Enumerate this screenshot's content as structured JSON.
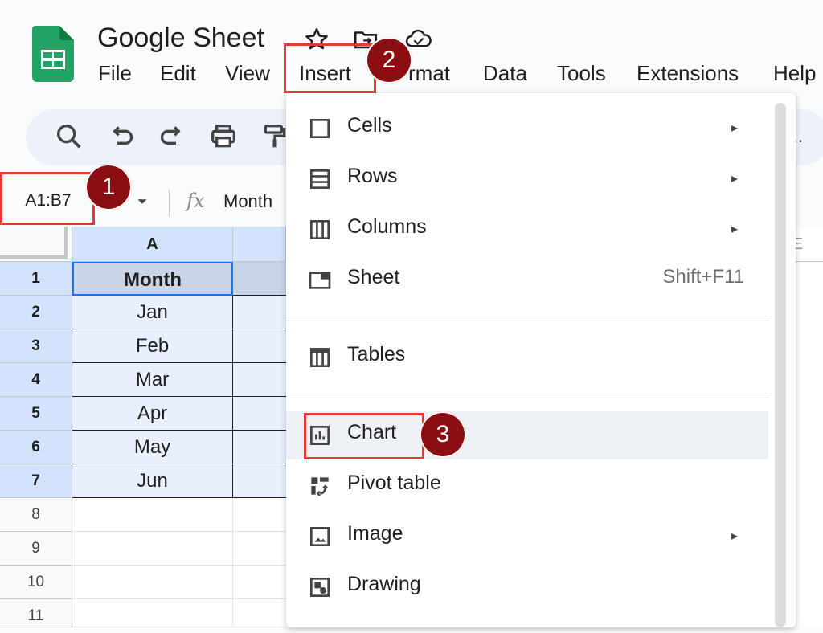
{
  "app": {
    "doc_title": "Google Sheet"
  },
  "menubar": [
    "File",
    "Edit",
    "View",
    "Insert",
    "Format",
    "Data",
    "Tools",
    "Extensions",
    "Help"
  ],
  "menubar_visible": [
    "File",
    "Edit",
    "View",
    "Insert",
    "rmat",
    "Data",
    "Tools",
    "Extensions",
    "Help"
  ],
  "toolbar": {
    "overflow": ".."
  },
  "formula_bar": {
    "name_box": "A1:B7",
    "fx": "fx",
    "value": "Month"
  },
  "grid": {
    "col_headers": [
      "A"
    ],
    "col_header_b_fragment": "E",
    "rows": [
      {
        "num": "1",
        "a": "Month"
      },
      {
        "num": "2",
        "a": "Jan"
      },
      {
        "num": "3",
        "a": "Feb"
      },
      {
        "num": "4",
        "a": "Mar"
      },
      {
        "num": "5",
        "a": "Apr"
      },
      {
        "num": "6",
        "a": "May"
      },
      {
        "num": "7",
        "a": "Jun"
      },
      {
        "num": "8",
        "a": ""
      },
      {
        "num": "9",
        "a": ""
      },
      {
        "num": "10",
        "a": ""
      },
      {
        "num": "11",
        "a": ""
      }
    ]
  },
  "insert_menu": {
    "items": [
      {
        "label": "Cells",
        "icon": "cells-icon",
        "submenu": true
      },
      {
        "label": "Rows",
        "icon": "rows-icon",
        "submenu": true
      },
      {
        "label": "Columns",
        "icon": "columns-icon",
        "submenu": true
      },
      {
        "label": "Sheet",
        "icon": "sheet-icon",
        "shortcut": "Shift+F11"
      },
      {
        "label": "Tables",
        "icon": "tables-icon"
      },
      {
        "label": "Chart",
        "icon": "chart-icon",
        "highlighted": true
      },
      {
        "label": "Pivot table",
        "icon": "pivot-table-icon"
      },
      {
        "label": "Image",
        "icon": "image-icon",
        "submenu": true
      },
      {
        "label": "Drawing",
        "icon": "drawing-icon"
      }
    ],
    "submenu_arrow": "▸"
  },
  "callouts": [
    "1",
    "2",
    "3"
  ],
  "colors": {
    "accent": "#0b57d0",
    "selection": "#d3e3fd",
    "callout_red": "#e53935",
    "badge": "#8b0e12"
  }
}
